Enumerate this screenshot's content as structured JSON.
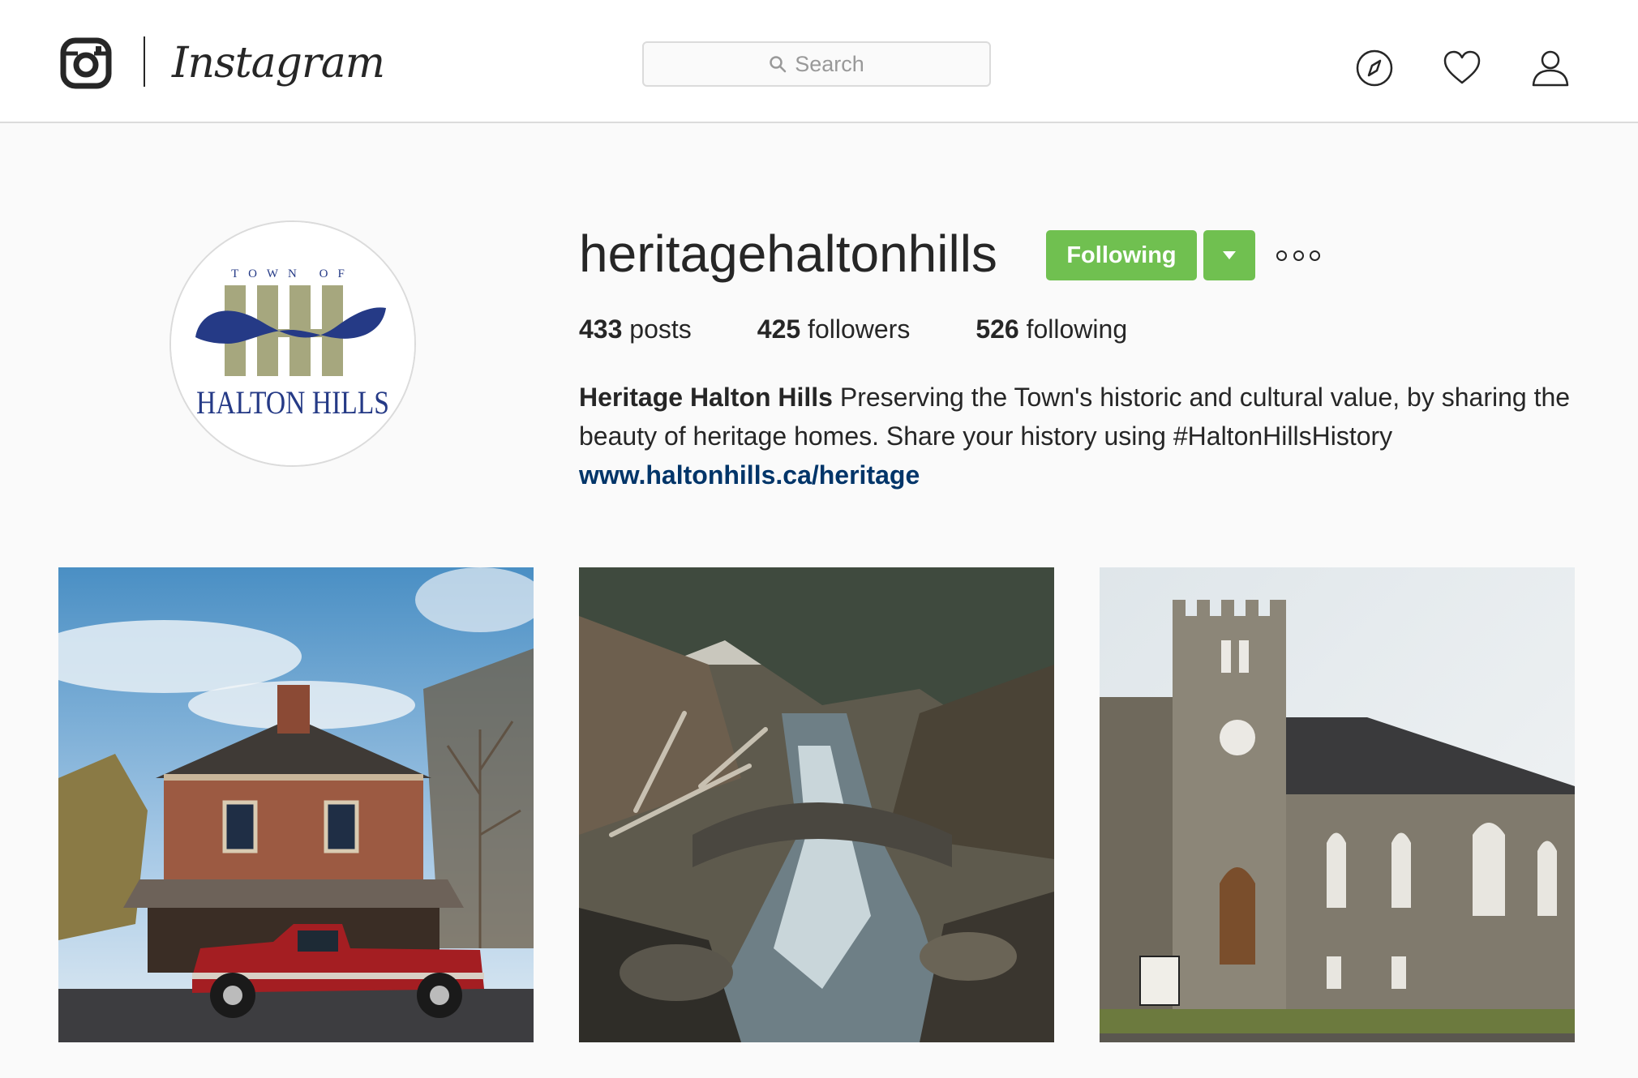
{
  "app": {
    "name": "Instagram"
  },
  "search": {
    "placeholder": "Search"
  },
  "nav": {
    "icons": [
      "compass-icon",
      "heart-icon",
      "user-icon"
    ]
  },
  "profile": {
    "username": "heritagehaltonhills",
    "follow_button": "Following",
    "stats": {
      "posts_count": "433",
      "posts_label": "posts",
      "followers_count": "425",
      "followers_label": "followers",
      "following_count": "526",
      "following_label": "following"
    },
    "bio_name": "Heritage Halton Hills",
    "bio_text": "Preserving the Town's historic and cultural value, by sharing the beauty of heritage homes. Share your history using #HaltonHillsHistory",
    "website": "www.haltonhills.ca/heritage",
    "avatar": {
      "top_text": "TOWN OF",
      "bottom_text": "HALTON HILLS"
    }
  },
  "grid": [
    {
      "subject": "brick-heritage-house-red-truck"
    },
    {
      "subject": "forest-creek-stone-bridge"
    },
    {
      "subject": "stone-church"
    }
  ],
  "colors": {
    "accent_green": "#70c050",
    "link": "#003569",
    "logo_blue": "#253a86",
    "logo_olive": "#a6a77e"
  }
}
